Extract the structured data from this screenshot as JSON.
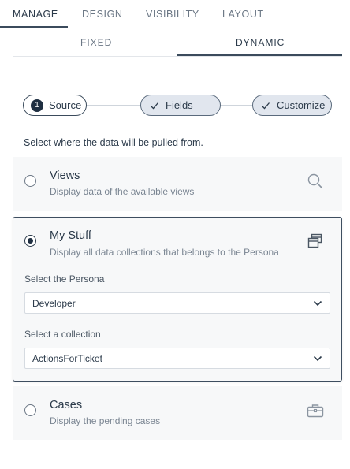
{
  "top_tabs": [
    {
      "label": "MANAGE",
      "active": true
    },
    {
      "label": "DESIGN",
      "active": false
    },
    {
      "label": "VISIBILITY",
      "active": false
    },
    {
      "label": "LAYOUT",
      "active": false
    }
  ],
  "sub_tabs": [
    {
      "label": "FIXED",
      "active": false
    },
    {
      "label": "DYNAMIC",
      "active": true
    }
  ],
  "stepper": {
    "steps": [
      {
        "number": "1",
        "label": "Source",
        "state": "current"
      },
      {
        "label": "Fields",
        "state": "done",
        "icon": "check-icon"
      },
      {
        "label": "Customize",
        "state": "done",
        "icon": "check-icon"
      }
    ]
  },
  "instruction": "Select where the data will be pulled from.",
  "options": {
    "views": {
      "title": "Views",
      "description": "Display data of the available views",
      "icon": "search-icon",
      "selected": false
    },
    "my_stuff": {
      "title": "My Stuff",
      "description": "Display all data collections that belongs to the Persona",
      "icon": "stacked-windows-icon",
      "selected": true,
      "persona_label": "Select the Persona",
      "persona_value": "Developer",
      "collection_label": "Select a collection",
      "collection_value": "ActionsForTicket"
    },
    "cases": {
      "title": "Cases",
      "description": "Display the pending cases",
      "icon": "briefcase-icon",
      "selected": false
    }
  },
  "colors": {
    "accent": "#1f2f42",
    "border": "#3e4e60",
    "muted_text": "#7a8592",
    "card_bg": "#f7f8f9"
  }
}
